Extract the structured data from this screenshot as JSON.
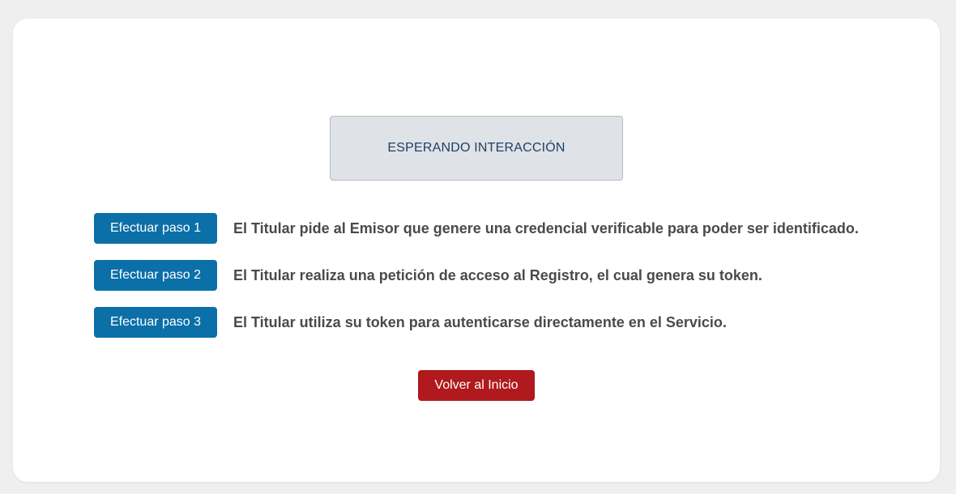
{
  "status": {
    "text": "ESPERANDO INTERACCIÓN"
  },
  "steps": [
    {
      "button_label": "Efectuar paso 1",
      "description": "El Titular pide al Emisor que genere una credencial verificable para poder ser identificado."
    },
    {
      "button_label": "Efectuar paso 2",
      "description": "El Titular realiza una petición de acceso al Registro, el cual genera su token."
    },
    {
      "button_label": "Efectuar paso 3",
      "description": "El Titular utiliza su token para autenticarse directamente en el Servicio."
    }
  ],
  "actions": {
    "back_label": "Volver al Inicio"
  },
  "colors": {
    "step_button": "#0b6fa8",
    "back_button": "#b0191d",
    "status_background": "#dfe2e7",
    "status_text": "#1f3f63"
  }
}
